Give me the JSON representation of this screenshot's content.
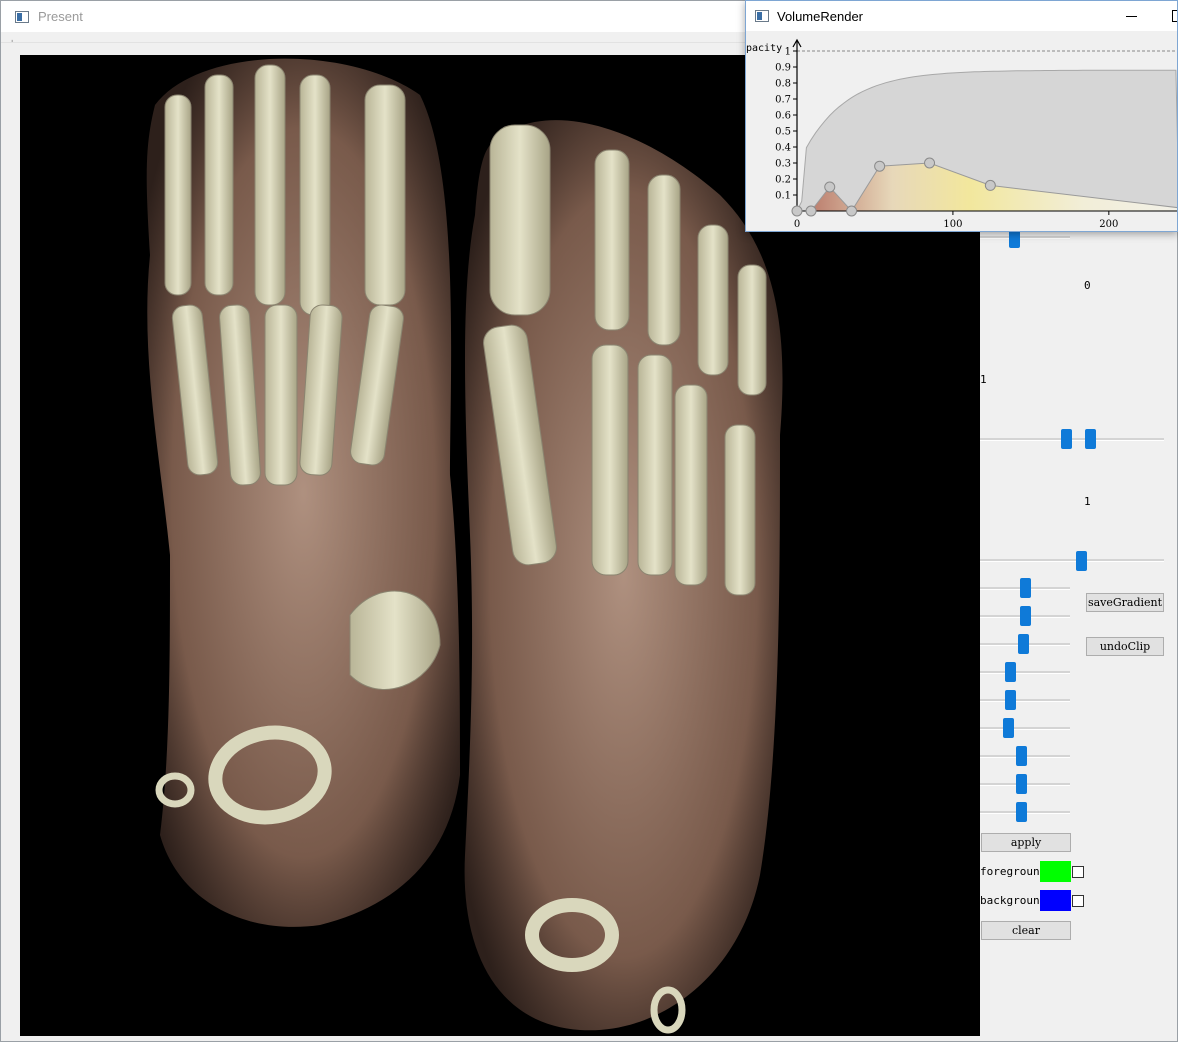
{
  "present_window": {
    "title": "Present",
    "menu_glyph": "ˌ"
  },
  "panel": {
    "value_top": "0",
    "value_mid_left": "1",
    "value_mid": "1",
    "buttons": {
      "save_gradient": "saveGradient",
      "undo_clip": "undoClip",
      "apply": "apply",
      "clear": "clear"
    },
    "foreground_label": "foreground",
    "background_label": "background",
    "foreground_color": "#00ff00",
    "background_color": "#0000ff",
    "slider_levels": {
      "range_low": 0.47,
      "range_high": 0.6,
      "top": 0.38,
      "mid": 0.55,
      "groups": [
        0.5,
        0.5,
        0.48,
        0.33,
        0.33,
        0.31,
        0.45,
        0.46,
        0.45
      ]
    }
  },
  "volume_render": {
    "title": "VolumeRender",
    "axis_y_label": "pacity",
    "curve_points": [
      {
        "x": 0,
        "y": 0
      },
      {
        "x": 9,
        "y": 0
      },
      {
        "x": 21,
        "y": 0.15
      },
      {
        "x": 35,
        "y": 0
      },
      {
        "x": 53,
        "y": 0.28
      },
      {
        "x": 85,
        "y": 0.3
      },
      {
        "x": 124,
        "y": 0.16
      }
    ]
  },
  "chart_data": {
    "type": "area",
    "xlabel": "",
    "ylabel": "pacity",
    "x_ticks": [
      "0",
      "100",
      "200"
    ],
    "y_ticks": [
      "0.1",
      "0.2",
      "0.3",
      "0.4",
      "0.5",
      "0.6",
      "0.7",
      "0.8",
      "0.9",
      "1"
    ],
    "ylim": [
      0,
      1
    ],
    "xlim": [
      0,
      245
    ],
    "series": [
      {
        "values_x": [
          0,
          9,
          21,
          35,
          53,
          85,
          124
        ],
        "values_y": [
          0,
          0,
          0.15,
          0,
          0.28,
          0.3,
          0.16
        ]
      }
    ]
  }
}
